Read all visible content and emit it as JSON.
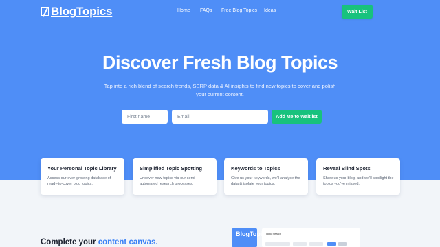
{
  "brand": {
    "name": "BlogTopics"
  },
  "nav": {
    "items": [
      "Home",
      "FAQs",
      "Free Blog Topics",
      "Ideas"
    ]
  },
  "header": {
    "cta_label": "Wait List"
  },
  "hero": {
    "title": "Discover Fresh Blog Topics",
    "subtitle": "Tap into a rich blend of search trends, SERP data & AI insights to find new topics to cover and polish your current content.",
    "first_name_placeholder": "First name",
    "email_placeholder": "Email",
    "submit_label": "Add Me to Waitlist"
  },
  "features": [
    {
      "title": "Your Personal Topic Library",
      "desc": "Access our ever-growing database of ready-to-cover blog topics."
    },
    {
      "title": "Simplified Topic Spotting",
      "desc": "Uncover new topics via our semi-automated research processes."
    },
    {
      "title": "Keywords to Topics",
      "desc": "Give us your keywords, we'll analyse the data & isolate your topics."
    },
    {
      "title": "Reveal Blind Spots",
      "desc": "Show us your blog, and we'll spotlight the topics you've missed."
    }
  ],
  "section": {
    "title_start": "Complete your ",
    "title_accent": "content canvas."
  },
  "preview": {
    "logo": "BlogTopics",
    "panel_label": "Topic Search"
  },
  "colors": {
    "hero_bg": "#4f8ef7",
    "accent_green": "#18c27d",
    "accent_blue": "#3b82f6"
  }
}
